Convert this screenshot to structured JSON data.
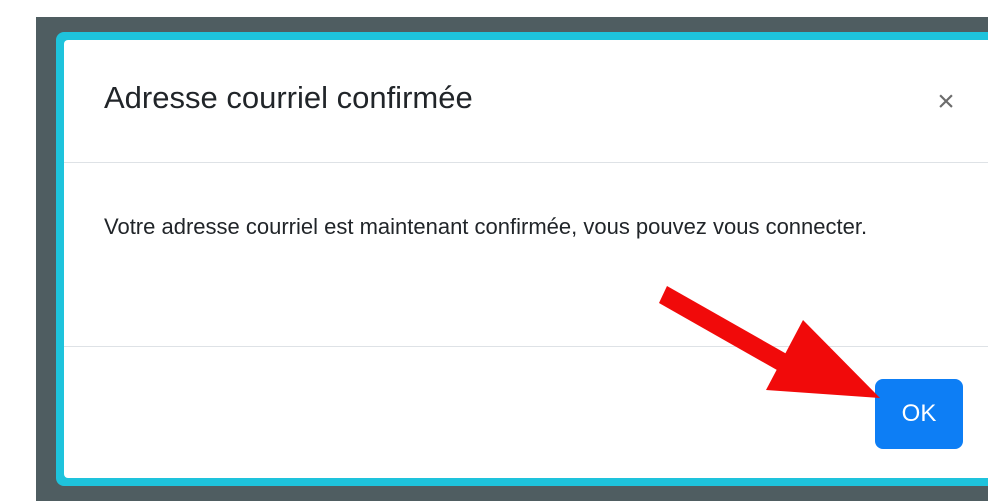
{
  "modal": {
    "title": "Adresse courriel confirmée",
    "close_icon": "close-icon",
    "close_glyph": "×",
    "body_text": "Votre adresse courriel est maintenant confirmée, vous pouvez vous connecter.",
    "ok_label": "OK"
  },
  "annotation": {
    "icon": "arrow-icon",
    "color": "#f10a0a"
  },
  "colors": {
    "backdrop": "#4f5d61",
    "outline": "#1ec3dc",
    "primary_button": "#0d7ef5"
  }
}
